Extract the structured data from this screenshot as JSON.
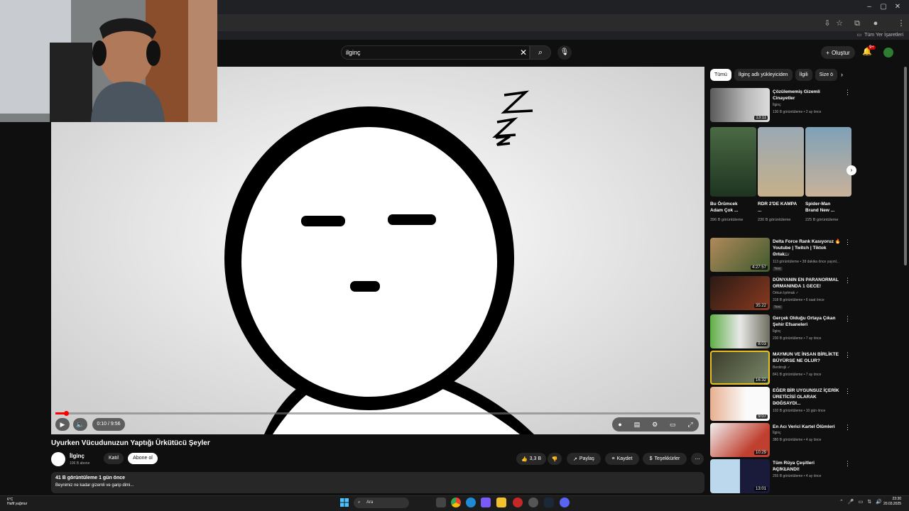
{
  "browser": {
    "window_controls": [
      "–",
      "▢",
      "✕"
    ],
    "bookmarks_folder": "Tüm Yer İşaretleri"
  },
  "youtube": {
    "search_value": "ilginç",
    "create_label": "Oluştur",
    "notifications_badge": "9+"
  },
  "player": {
    "time": "0:10 / 9:56",
    "progress_fraction": 0.017
  },
  "video": {
    "title": "Uyurken Vücudunuzun Yaptığı Ürkütücü Şeyler",
    "channel": "İlginç",
    "subscribers": "106 B abone",
    "join_label": "Katıl",
    "subscribe_label": "Abone ol",
    "likes": "3,3 B",
    "share_label": "Paylaş",
    "save_label": "Kaydet",
    "thanks_label": "Teşekkürler",
    "desc_stats": "41 B görüntüleme  1 gün önce",
    "desc_text": "Beynimiz ne kadar gizemli ve garip dimi..."
  },
  "chips": [
    "Tümü",
    "İlginç adlı yükleyiciden",
    "İlgili",
    "Size ö"
  ],
  "shorts": [
    {
      "title": "Bu Örümcek Adam Çok ...",
      "views": "396 B görüntüleme"
    },
    {
      "title": "RDR 2'DE KAMPA ...",
      "views": "230 B görüntüleme"
    },
    {
      "title": "Spider-Man Brand New ...",
      "views": "225 B görüntüleme"
    }
  ],
  "recommendations": [
    {
      "title": "Çözülememiş Gizemli Cinayetler",
      "channel": "İlginç",
      "meta": "130 B görüntüleme • 2 ay önce",
      "duration": "13:11",
      "new": ""
    },
    {
      "title": "Delta Force Rank Kasıyoruz 🔥 Youtube | Twitch | Tiktok Ortak...",
      "channel": "Arsenn TV",
      "meta": "113 görüntüleme • 38 dakika önce yayınl...",
      "duration": "4:27:57",
      "new": "Yeni"
    },
    {
      "title": "DÜNYANIN EN PARANORMAL ORMANINDA 1 GECE!",
      "channel": "Orkun Işıtmak ✓",
      "meta": "318 B görüntüleme • 6 saat önce",
      "duration": "35:22",
      "new": "Yeni"
    },
    {
      "title": "Gerçek Olduğu Ortaya Çıkan Şehir Efsaneleri",
      "channel": "İlginç",
      "meta": "230 B görüntüleme • 7 ay önce",
      "duration": "8:03",
      "new": ""
    },
    {
      "title": "MAYMUN VE İNSAN BİRLİKTE BÜYÜRSE NE OLUR?",
      "channel": "Benitrojii ✓",
      "meta": "841 B görüntüleme • 7 ay önce",
      "duration": "16:32",
      "new": ""
    },
    {
      "title": "EĞER BİR UYGUNSUZ İÇERİK ÜRETİCİSİ OLARAK DOĞSAYDI...",
      "channel": "Mitos",
      "meta": "102 B görüntüleme • 10 gün önce",
      "duration": "9:07",
      "new": ""
    },
    {
      "title": "En Acı Verici Kartel Ölümleri",
      "channel": "İlginç",
      "meta": "380 B görüntüleme • 4 ay önce",
      "duration": "10:29",
      "new": ""
    },
    {
      "title": "Tüm Rüya Çeşitleri AÇIKLANDI!",
      "channel": "Bob Açıklıyor",
      "meta": "255 B görüntüleme • 4 ay önce",
      "duration": "13:01",
      "new": ""
    }
  ],
  "taskbar": {
    "weather_temp": "6°C",
    "weather_desc": "Hafif yağmur",
    "search_label": "Ara",
    "time": "23:30",
    "date": "20.03.2025"
  },
  "colors": {
    "accent": "#ff0000",
    "bg": "#0f0f0f",
    "chip": "#272727"
  }
}
